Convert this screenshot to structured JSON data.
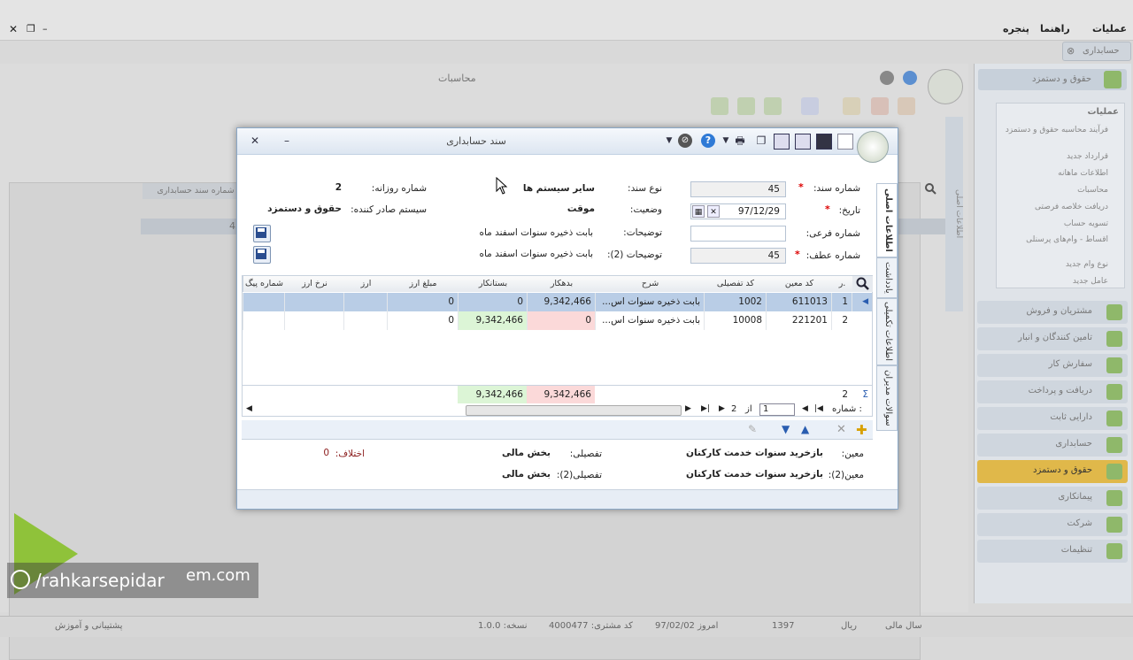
{
  "app": {
    "top_menu": [
      "عملیات",
      "راهنما",
      "پنجره"
    ],
    "tab_close_label": "حسابداری",
    "subwindow_title": "محاسبات",
    "left_col_header": "شماره سند حسابداری",
    "left_col_value": "45",
    "right_panel_title": "حقوق و دستمزد",
    "ops_header": "عملیات",
    "ops_items": [
      "فرآیند محاسبه حقوق و دستمزد",
      "قرارداد جدید",
      "اطلاعات ماهانه",
      "محاسبات",
      "دریافت خلاصه فرصتی",
      "تسویه حساب",
      "اقساط - وام‌های پرسنلی",
      "نوع وام جدید",
      "عامل جدید"
    ],
    "nav_items": [
      "مشتریان و فروش",
      "تامین کنندگان و انبار",
      "سفارش کار",
      "دریافت و پرداخت",
      "دارایی ثابت",
      "حسابداری",
      "حقوق و دستمزد",
      "پیمانکاری",
      "شرکت",
      "تنظیمات"
    ],
    "nav_active_index": 6,
    "status_left": "پشتیبانی و آموزش",
    "status_items": [
      "سال مالی",
      "ریال",
      "1397",
      "97/02/02 امروز",
      "کد مشتری: 4000477",
      "نسخه: 1.0.0"
    ],
    "watermark": "/rahkarsepidar",
    "watermark_domain": "em.com",
    "side_vertical_labels": [
      "اطلاعات اصلی",
      "شماره سند"
    ]
  },
  "dialog": {
    "title": "سند حسابداری",
    "fields": {
      "doc_no_label": "شماره سند:",
      "doc_no": "45",
      "date_label": "تاریخ:",
      "date": "97/12/29",
      "sub_no_label": "شماره فرعی:",
      "sub_no": "",
      "ref_no_label": "شماره عطف:",
      "ref_no": "45",
      "doc_type_label": "نوع سند:",
      "doc_type": "سایر سیستم ها",
      "status_label": "وضعیت:",
      "status": "موقت",
      "desc_label": "توضیحات:",
      "desc": "بابت ذخیره سنوات اسفند ماه",
      "desc2_label": "توضیحات (2):",
      "desc2": "بابت ذخیره سنوات اسفند ماه",
      "daily_no_label": "شماره روزانه:",
      "daily_no": "2",
      "issuer_label": "سیستم صادر کننده:",
      "issuer": "حقوق و دستمزد"
    },
    "grid": {
      "headers": [
        "ر.",
        "کد معین",
        "کد تفصیلی",
        "شرح",
        "بدهکار",
        "بستانکار",
        "مبلغ ارز",
        "ارز",
        "نرخ ارز",
        "شماره پیگ"
      ],
      "rows": [
        [
          "1",
          "611013",
          "1002",
          "بابت ذخیره سنوات اس...",
          "9,342,466",
          "0",
          "0",
          "",
          "",
          ""
        ],
        [
          "2",
          "221201",
          "10008",
          "بابت ذخیره سنوات اس...",
          "0",
          "9,342,466",
          "0",
          "",
          "",
          ""
        ]
      ],
      "summary_count": "2",
      "summary_debit": "9,342,466",
      "summary_credit": "9,342,466",
      "pager_label": "شماره :",
      "pager_current": "1",
      "pager_of": "از",
      "pager_total": "2"
    },
    "footer": {
      "moein_label": "معین:",
      "moein": "بازخرید سنوات خدمت کارکنان",
      "moein2_label": "معین(2):",
      "moein2": "بازخرید سنوات خدمت کارکنان",
      "tafsili_label": "تفصیلی:",
      "tafsili": "بخش مالی",
      "tafsili2_label": "تفصیلی(2):",
      "tafsili2": "بخش مالی",
      "diff_label": "اختلاف:",
      "diff": "0"
    },
    "side_tabs": [
      "اطلاعات اصلی",
      "یادداشت",
      "اطلاعات تکمیلی",
      "سوالات مدیران"
    ]
  },
  "colors": {
    "accent": "#e0b84a",
    "selected_row": "#b9cde6",
    "debit_bg": "#fbd9d9",
    "credit_bg": "#dcf5d6"
  }
}
